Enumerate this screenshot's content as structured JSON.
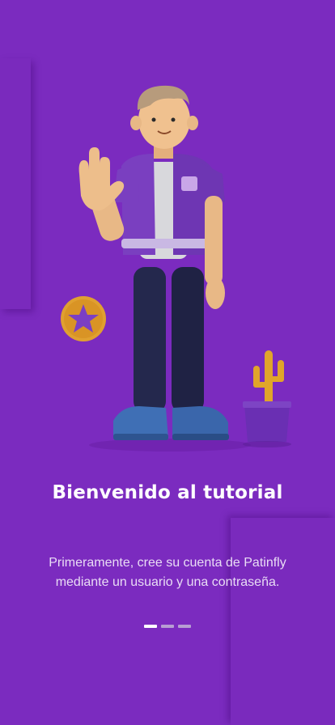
{
  "tutorial": {
    "title": "Bienvenido al tutorial",
    "description": "Primeramente, cree su cuenta de Patinfly mediante un usuario y una contraseña.",
    "pager": {
      "total": 3,
      "current": 1
    }
  },
  "colors": {
    "background": "#7b2bbf",
    "title_text": "#ffffff",
    "body_text": "#e9dcf5",
    "dot_active": "#ffffff",
    "dot_inactive": "#b79ed3",
    "star_badge": "#e0a030",
    "plant_pot": "#6a2fb3",
    "cactus": "#e0a52a"
  },
  "illustration": {
    "icons": [
      "waving-character",
      "star-badge-icon",
      "cactus-plant-icon"
    ]
  }
}
